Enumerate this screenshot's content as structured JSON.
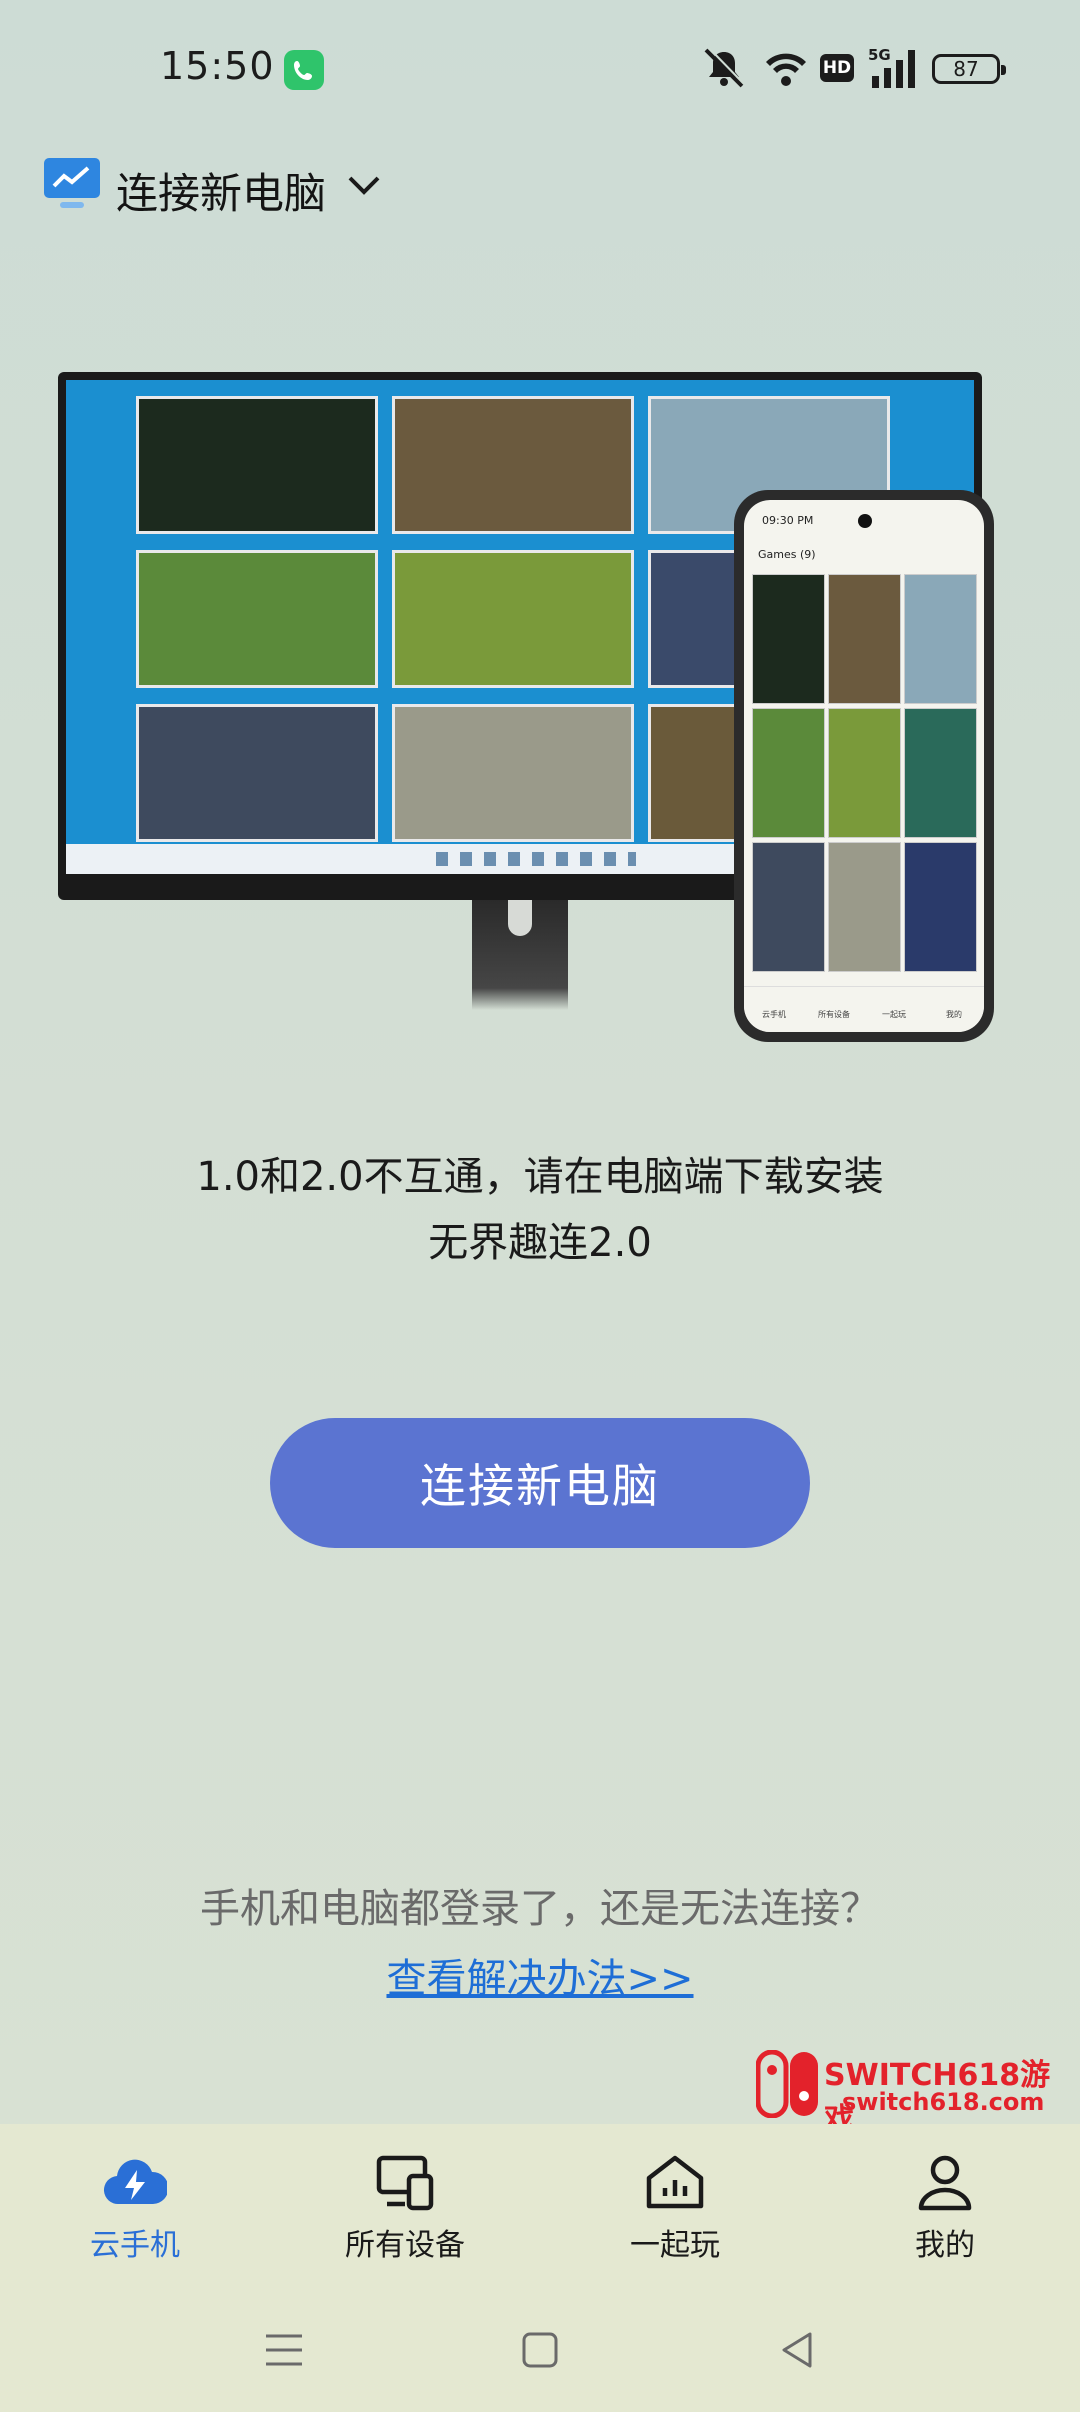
{
  "status_bar": {
    "time": "15:50",
    "hd_label": "HD",
    "network_label": "5G",
    "battery_level": "87"
  },
  "header": {
    "title": "连接新电脑"
  },
  "illustration": {
    "phone_time": "09:30 PM",
    "phone_header": "Games (9)",
    "phone_nav": [
      "云手机",
      "所有设备",
      "一起玩",
      "我的"
    ]
  },
  "message": {
    "line1": "1.0和2.0不互通，请在电脑端下载安装",
    "line2": "无界趣连2.0"
  },
  "connect_button": {
    "label": "连接新电脑"
  },
  "help": {
    "question": "手机和电脑都登录了，还是无法连接？",
    "link": "查看解决办法>>"
  },
  "watermark": {
    "line1": "SWITCH618游戏",
    "line2": "switch618.com"
  },
  "bottom_nav": {
    "items": [
      {
        "label": "云手机",
        "icon": "cloud-phone-icon",
        "active": true
      },
      {
        "label": "所有设备",
        "icon": "devices-icon",
        "active": false
      },
      {
        "label": "一起玩",
        "icon": "home-chart-icon",
        "active": false
      },
      {
        "label": "我的",
        "icon": "person-icon",
        "active": false
      }
    ]
  },
  "colors": {
    "accent": "#5b74d1",
    "active_nav": "#2a6fd6",
    "link": "#1e6ed6",
    "background": "#d3ded4"
  }
}
